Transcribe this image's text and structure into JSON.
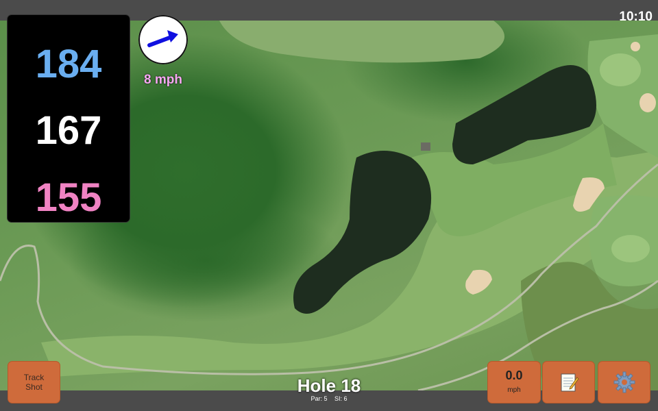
{
  "status": {
    "time": "10:10"
  },
  "distances": {
    "back": "184",
    "middle": "167",
    "front": "155"
  },
  "wind": {
    "speed": "8 mph",
    "icon": "wind-arrow-icon",
    "arrow_color": "#1010e0"
  },
  "hole": {
    "title": "Hole 18",
    "par": "Par: 5",
    "si": "SI: 6"
  },
  "buttons": {
    "track_shot": "Track\nShot",
    "speed_value": "0.0",
    "speed_unit": "mph",
    "notes_icon": "notepad-icon",
    "settings_icon": "gear-icon"
  },
  "colors": {
    "back_distance": "#6aaef0",
    "middle_distance": "#ffffff",
    "front_distance": "#f083c3",
    "button": "#cf6b3b",
    "wind_text": "#f7a8f2"
  }
}
